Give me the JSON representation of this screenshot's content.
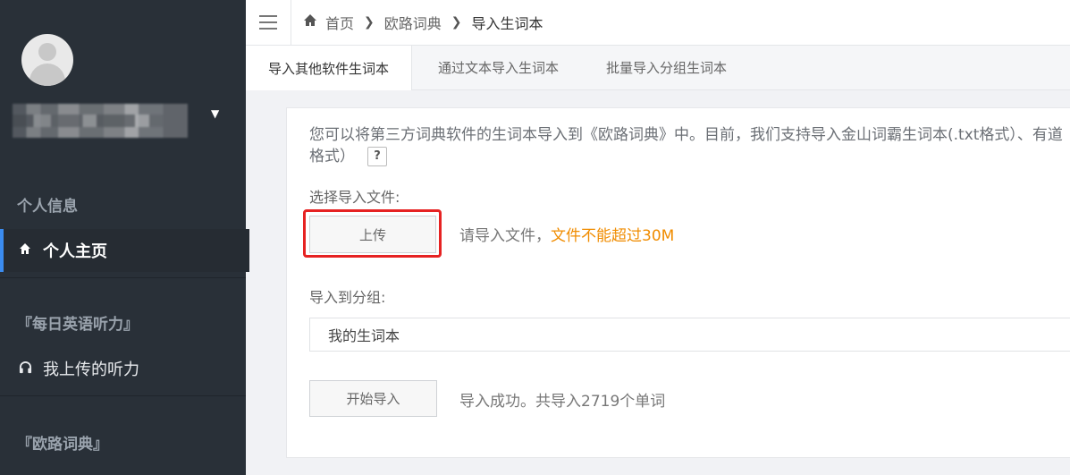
{
  "sidebar": {
    "username_caret": "▼",
    "sections": [
      {
        "title": "个人信息"
      },
      {
        "title": "『每日英语听力』"
      },
      {
        "title": "『欧路词典』"
      }
    ],
    "items": [
      {
        "label": "个人主页",
        "icon": "home-icon",
        "active": true
      },
      {
        "label": "我上传的听力",
        "icon": "headphones-icon",
        "active": false
      }
    ]
  },
  "breadcrumb": {
    "items": [
      "首页",
      "欧路词典",
      "导入生词本"
    ]
  },
  "tabs": [
    {
      "label": "导入其他软件生词本",
      "active": true
    },
    {
      "label": "通过文本导入生词本",
      "active": false
    },
    {
      "label": "批量导入分组生词本",
      "active": false
    }
  ],
  "form": {
    "intro_line1": "您可以将第三方词典软件的生词本导入到《欧路词典》中。目前，我们支持导入金山词霸生词本(.txt格式）、有道",
    "intro_line2": "格式）",
    "help_label": "?",
    "file_label": "选择导入文件:",
    "upload_button": "上传",
    "file_hint": "请导入文件，",
    "file_limit": "文件不能超过30M",
    "group_label": "导入到分组:",
    "group_value": "我的生词本",
    "start_button": "开始导入",
    "result_text": "导入成功。共导入2719个单词"
  },
  "colors": {
    "sidebar_bg": "#293038",
    "accent": "#3b8cf0",
    "warning": "#f08c00",
    "highlight_border": "#e62222"
  }
}
